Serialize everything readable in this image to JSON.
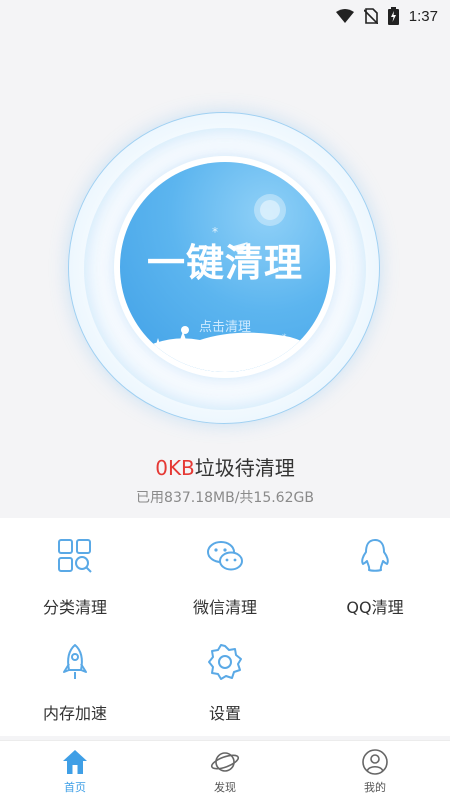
{
  "status_bar": {
    "time": "1:37"
  },
  "hero": {
    "title": "一键清理",
    "subtitle": "点击清理",
    "junk_amount": "0KB",
    "junk_suffix": "垃圾待清理",
    "storage": "已用837.18MB/共15.62GB"
  },
  "features": [
    {
      "label": "分类清理",
      "icon": "category-grid-search-icon"
    },
    {
      "label": "微信清理",
      "icon": "wechat-icon"
    },
    {
      "label": "QQ清理",
      "icon": "qq-penguin-icon"
    },
    {
      "label": "内存加速",
      "icon": "rocket-icon"
    },
    {
      "label": "设置",
      "icon": "gear-icon"
    }
  ],
  "bottom_nav": {
    "items": [
      {
        "label": "首页",
        "icon": "home-icon",
        "active": true
      },
      {
        "label": "发现",
        "icon": "planet-icon",
        "active": false
      },
      {
        "label": "我的",
        "icon": "user-icon",
        "active": false
      }
    ]
  },
  "colors": {
    "accent": "#3f9fe6",
    "junk_number": "#e53935",
    "icon_stroke": "#5aa9e6"
  }
}
